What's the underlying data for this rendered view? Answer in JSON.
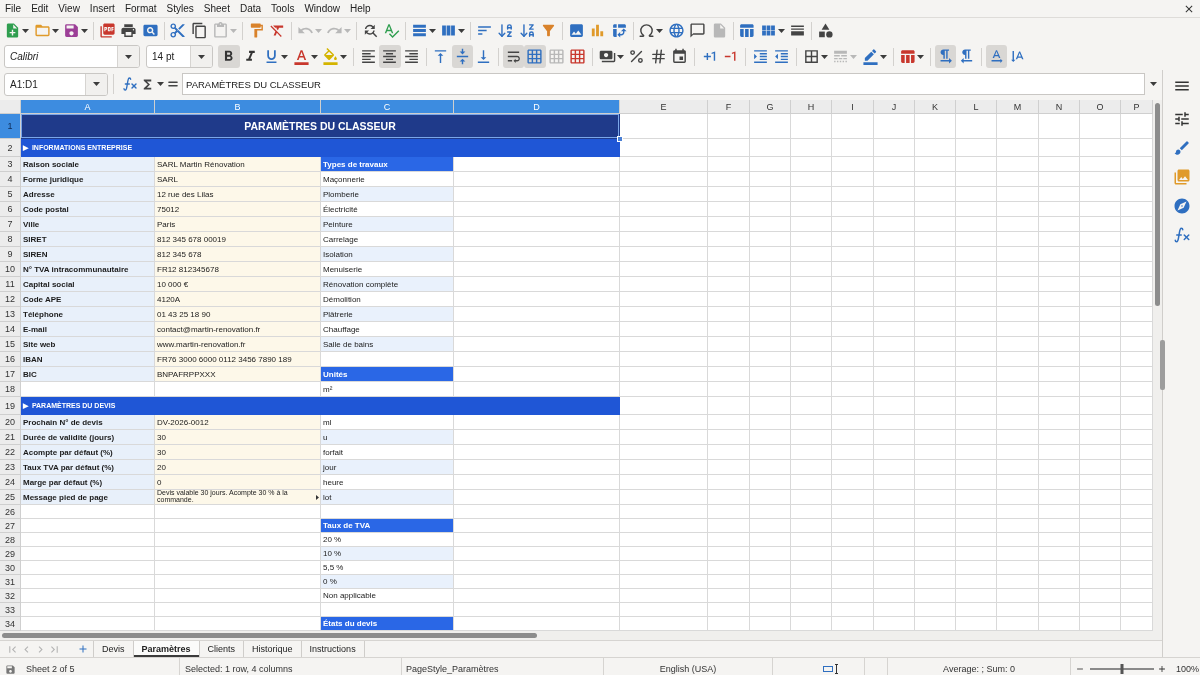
{
  "menu_bar": {
    "items": [
      "File",
      "Edit",
      "View",
      "Insert",
      "Format",
      "Styles",
      "Sheet",
      "Data",
      "Tools",
      "Window",
      "Help"
    ]
  },
  "standard_toolbar": {
    "groups": [
      [
        {
          "kind": "new",
          "dropdown": true,
          "disabled": false
        },
        {
          "kind": "open",
          "dropdown": true,
          "disabled": false
        },
        {
          "kind": "save",
          "dropdown": true,
          "disabled": false
        }
      ],
      [
        {
          "kind": "export_pdf",
          "dropdown": false,
          "disabled": false
        },
        {
          "kind": "print",
          "dropdown": false,
          "disabled": false
        },
        {
          "kind": "print_preview",
          "dropdown": false,
          "disabled": false
        }
      ],
      [
        {
          "kind": "cut",
          "dropdown": false,
          "disabled": false
        },
        {
          "kind": "copy",
          "dropdown": false,
          "disabled": false
        },
        {
          "kind": "paste",
          "dropdown": true,
          "disabled": true
        }
      ],
      [
        {
          "kind": "clone_formatting",
          "dropdown": false,
          "disabled": false
        },
        {
          "kind": "clear_formatting",
          "dropdown": false,
          "disabled": false
        }
      ],
      [
        {
          "kind": "undo",
          "dropdown": true,
          "disabled": true
        },
        {
          "kind": "redo",
          "dropdown": true,
          "disabled": true
        }
      ],
      [
        {
          "kind": "find_replace",
          "dropdown": false,
          "disabled": false
        },
        {
          "kind": "spelling",
          "dropdown": false,
          "disabled": false
        }
      ],
      [
        {
          "kind": "row",
          "dropdown": true,
          "disabled": false
        },
        {
          "kind": "column",
          "dropdown": true,
          "disabled": false
        }
      ],
      [
        {
          "kind": "sort",
          "dropdown": false,
          "disabled": false
        },
        {
          "kind": "sort_ascending",
          "dropdown": false,
          "disabled": false
        },
        {
          "kind": "sort_descending",
          "dropdown": false,
          "disabled": false
        },
        {
          "kind": "autofilter",
          "dropdown": false,
          "disabled": false
        }
      ],
      [
        {
          "kind": "image",
          "dropdown": false,
          "disabled": false
        },
        {
          "kind": "chart",
          "dropdown": false,
          "disabled": false
        },
        {
          "kind": "pivot_table",
          "dropdown": false,
          "disabled": false
        }
      ],
      [
        {
          "kind": "special_character",
          "dropdown": true,
          "disabled": false
        },
        {
          "kind": "hyperlink",
          "dropdown": false,
          "disabled": false
        },
        {
          "kind": "comment",
          "dropdown": false,
          "disabled": false
        },
        {
          "kind": "headers_footers",
          "dropdown": false,
          "disabled": true
        }
      ],
      [
        {
          "kind": "print_area",
          "dropdown": false,
          "disabled": false
        },
        {
          "kind": "freeze",
          "dropdown": true,
          "disabled": false
        },
        {
          "kind": "split_window",
          "dropdown": false,
          "disabled": false
        }
      ],
      [
        {
          "kind": "shapes",
          "dropdown": false,
          "disabled": false
        }
      ]
    ]
  },
  "formatting_toolbar": {
    "font_name": "Calibri",
    "font_size": "14 pt",
    "groups": [
      [
        {
          "kind": "bold",
          "dropdown": false,
          "pressed": true,
          "disabled": false
        },
        {
          "kind": "italic",
          "dropdown": false,
          "pressed": false,
          "disabled": false
        },
        {
          "kind": "underline",
          "dropdown": true,
          "pressed": false,
          "disabled": false
        },
        {
          "kind": "font_color",
          "dropdown": true,
          "pressed": false,
          "disabled": false
        },
        {
          "kind": "highlighting",
          "dropdown": true,
          "pressed": false,
          "disabled": false
        }
      ],
      [
        {
          "kind": "align_left",
          "dropdown": false,
          "pressed": false,
          "disabled": false
        },
        {
          "kind": "align_center",
          "dropdown": false,
          "pressed": true,
          "disabled": false
        },
        {
          "kind": "align_right",
          "dropdown": false,
          "pressed": false,
          "disabled": false
        }
      ],
      [
        {
          "kind": "align_top",
          "dropdown": false,
          "pressed": false,
          "disabled": false
        },
        {
          "kind": "align_middle",
          "dropdown": false,
          "pressed": true,
          "disabled": false
        },
        {
          "kind": "align_bottom",
          "dropdown": false,
          "pressed": false,
          "disabled": false
        }
      ],
      [
        {
          "kind": "wrap_text",
          "dropdown": false,
          "pressed": true,
          "disabled": false
        },
        {
          "kind": "merge_center",
          "dropdown": false,
          "pressed": true,
          "disabled": false
        },
        {
          "kind": "merge",
          "dropdown": false,
          "pressed": false,
          "disabled": true
        },
        {
          "kind": "unmerge",
          "dropdown": false,
          "pressed": false,
          "disabled": false
        }
      ],
      [
        {
          "kind": "currency",
          "dropdown": true,
          "pressed": false,
          "disabled": false
        },
        {
          "kind": "percent",
          "dropdown": false,
          "pressed": false,
          "disabled": false
        },
        {
          "kind": "number",
          "dropdown": false,
          "pressed": false,
          "disabled": false
        },
        {
          "kind": "date",
          "dropdown": false,
          "pressed": false,
          "disabled": false
        }
      ],
      [
        {
          "kind": "add_decimal",
          "dropdown": false,
          "pressed": false,
          "disabled": false
        },
        {
          "kind": "delete_decimal",
          "dropdown": false,
          "pressed": false,
          "disabled": false
        }
      ],
      [
        {
          "kind": "indent_increase",
          "dropdown": false,
          "pressed": false,
          "disabled": false
        },
        {
          "kind": "indent_decrease",
          "dropdown": false,
          "pressed": false,
          "disabled": false
        }
      ],
      [
        {
          "kind": "borders",
          "dropdown": true,
          "pressed": false,
          "disabled": false
        },
        {
          "kind": "border_style",
          "dropdown": true,
          "pressed": false,
          "disabled": true
        },
        {
          "kind": "border_color",
          "dropdown": true,
          "pressed": false,
          "disabled": false
        }
      ],
      [
        {
          "kind": "conditional",
          "dropdown": true,
          "pressed": false,
          "disabled": false
        }
      ],
      [
        {
          "kind": "left_to_right",
          "dropdown": false,
          "pressed": true,
          "disabled": false
        },
        {
          "kind": "right_to_left",
          "dropdown": false,
          "pressed": false,
          "disabled": false
        }
      ],
      [
        {
          "kind": "text_orientation",
          "dropdown": false,
          "pressed": true,
          "disabled": false
        },
        {
          "kind": "vertical_text",
          "dropdown": false,
          "pressed": false,
          "disabled": false
        }
      ]
    ]
  },
  "formula_bar": {
    "name_box": "A1:D1",
    "content": "PARAMÈTRES DU CLASSEUR"
  },
  "sheet": {
    "columns": [
      {
        "label": "A",
        "selected": true
      },
      {
        "label": "B",
        "selected": true
      },
      {
        "label": "C",
        "selected": true
      },
      {
        "label": "D",
        "selected": true
      },
      {
        "label": "E",
        "selected": false
      },
      {
        "label": "F",
        "selected": false
      },
      {
        "label": "G",
        "selected": false
      },
      {
        "label": "H",
        "selected": false
      },
      {
        "label": "I",
        "selected": false
      },
      {
        "label": "J",
        "selected": false
      },
      {
        "label": "K",
        "selected": false
      },
      {
        "label": "L",
        "selected": false
      },
      {
        "label": "M",
        "selected": false
      },
      {
        "label": "N",
        "selected": false
      },
      {
        "label": "O",
        "selected": false
      },
      {
        "label": "P",
        "selected": false
      }
    ],
    "rows": [
      {
        "number": "1",
        "selected": true,
        "kind": "title",
        "title": "PARAMÈTRES DU CLASSEUR"
      },
      {
        "number": "2",
        "selected": false,
        "kind": "section",
        "text": "▶  INFORMATIONS ENTREPRISE"
      },
      {
        "number": "3",
        "selected": false,
        "kind": "data",
        "label": "Raison sociale",
        "value": "SARL Martin Rénovation",
        "clipped": false,
        "list": {
          "kind": "header",
          "text": "Types de travaux"
        }
      },
      {
        "number": "4",
        "selected": false,
        "kind": "data",
        "label": "Forme juridique",
        "value": "SARL",
        "clipped": false,
        "list": {
          "kind": "item",
          "text": "Maçonnerie",
          "shaded": false
        }
      },
      {
        "number": "5",
        "selected": false,
        "kind": "data",
        "label": "Adresse",
        "value": "12 rue des Lilas",
        "clipped": false,
        "list": {
          "kind": "item",
          "text": "Plomberie",
          "shaded": true
        }
      },
      {
        "number": "6",
        "selected": false,
        "kind": "data",
        "label": "Code postal",
        "value": "75012",
        "clipped": false,
        "list": {
          "kind": "item",
          "text": "Électricité",
          "shaded": false
        }
      },
      {
        "number": "7",
        "selected": false,
        "kind": "data",
        "label": "Ville",
        "value": "Paris",
        "clipped": false,
        "list": {
          "kind": "item",
          "text": "Peinture",
          "shaded": true
        }
      },
      {
        "number": "8",
        "selected": false,
        "kind": "data",
        "label": "SIRET",
        "value": "812 345 678 00019",
        "clipped": false,
        "list": {
          "kind": "item",
          "text": "Carrelage",
          "shaded": false
        }
      },
      {
        "number": "9",
        "selected": false,
        "kind": "data",
        "label": "SIREN",
        "value": "812 345 678",
        "clipped": false,
        "list": {
          "kind": "item",
          "text": "Isolation",
          "shaded": true
        }
      },
      {
        "number": "10",
        "selected": false,
        "kind": "data",
        "label": "N° TVA intracommunautaire",
        "value": "FR12 812345678",
        "clipped": false,
        "list": {
          "kind": "item",
          "text": "Menuiserie",
          "shaded": false
        }
      },
      {
        "number": "11",
        "selected": false,
        "kind": "data",
        "label": "Capital social",
        "value": "10 000 €",
        "clipped": false,
        "list": {
          "kind": "item",
          "text": "Rénovation complète",
          "shaded": true
        }
      },
      {
        "number": "12",
        "selected": false,
        "kind": "data",
        "label": "Code APE",
        "value": "4120A",
        "clipped": false,
        "list": {
          "kind": "item",
          "text": "Démolition",
          "shaded": false
        }
      },
      {
        "number": "13",
        "selected": false,
        "kind": "data",
        "label": "Téléphone",
        "value": "01 43 25 18 90",
        "clipped": false,
        "list": {
          "kind": "item",
          "text": "Plâtrerie",
          "shaded": true
        }
      },
      {
        "number": "14",
        "selected": false,
        "kind": "data",
        "label": "E-mail",
        "value": "contact@martin-renovation.fr",
        "clipped": false,
        "list": {
          "kind": "item",
          "text": "Chauffage",
          "shaded": false
        }
      },
      {
        "number": "15",
        "selected": false,
        "kind": "data",
        "label": "Site web",
        "value": "www.martin-renovation.fr",
        "clipped": false,
        "list": {
          "kind": "item",
          "text": "Salle de bains",
          "shaded": true
        }
      },
      {
        "number": "16",
        "selected": false,
        "kind": "data",
        "label": "IBAN",
        "value": "FR76 3000 6000 0112 3456 7890 189",
        "clipped": false
      },
      {
        "number": "17",
        "selected": false,
        "kind": "data",
        "label": "BIC",
        "value": "BNPAFRPPXXX",
        "clipped": false,
        "list": {
          "kind": "header",
          "text": "Unités"
        }
      },
      {
        "number": "18",
        "selected": false,
        "kind": "data",
        "list": {
          "kind": "item",
          "text": "m²",
          "shaded": false
        }
      },
      {
        "number": "19",
        "selected": false,
        "kind": "section",
        "text": "▶  PARAMÈTRES DU DEVIS"
      },
      {
        "number": "20",
        "selected": false,
        "kind": "data",
        "label": "Prochain N° de devis",
        "value": "DV-2026-0012",
        "clipped": false,
        "list": {
          "kind": "item",
          "text": "ml",
          "shaded": false
        }
      },
      {
        "number": "21",
        "selected": false,
        "kind": "data",
        "label": "Durée de validité (jours)",
        "value": "30",
        "clipped": false,
        "list": {
          "kind": "item",
          "text": "u",
          "shaded": true
        }
      },
      {
        "number": "22",
        "selected": false,
        "kind": "data",
        "label": "Acompte par défaut (%)",
        "value": "30",
        "clipped": false,
        "list": {
          "kind": "item",
          "text": "forfait",
          "shaded": false
        }
      },
      {
        "number": "23",
        "selected": false,
        "kind": "data",
        "label": "Taux TVA par défaut (%)",
        "value": "20",
        "clipped": false,
        "list": {
          "kind": "item",
          "text": "jour",
          "shaded": true
        }
      },
      {
        "number": "24",
        "selected": false,
        "kind": "data",
        "label": "Marge par défaut (%)",
        "value": "0",
        "clipped": false,
        "list": {
          "kind": "item",
          "text": "heure",
          "shaded": false
        }
      },
      {
        "number": "25",
        "selected": false,
        "kind": "data",
        "label": "Message pied de page",
        "value": "Devis valable 30 jours. Acompte 30 % à la commande.",
        "clipped": true,
        "list": {
          "kind": "item",
          "text": "lot",
          "shaded": true
        }
      },
      {
        "number": "26",
        "selected": false,
        "kind": "data"
      },
      {
        "number": "27",
        "selected": false,
        "kind": "data",
        "list": {
          "kind": "header",
          "text": "Taux de TVA"
        }
      },
      {
        "number": "28",
        "selected": false,
        "kind": "data",
        "list": {
          "kind": "item",
          "text": "20 %",
          "shaded": false
        }
      },
      {
        "number": "29",
        "selected": false,
        "kind": "data",
        "list": {
          "kind": "item",
          "text": "10 %",
          "shaded": true
        }
      },
      {
        "number": "30",
        "selected": false,
        "kind": "data",
        "list": {
          "kind": "item",
          "text": "5,5 %",
          "shaded": false
        }
      },
      {
        "number": "31",
        "selected": false,
        "kind": "data",
        "list": {
          "kind": "item",
          "text": "0 %",
          "shaded": true
        }
      },
      {
        "number": "32",
        "selected": false,
        "kind": "data",
        "list": {
          "kind": "item",
          "text": "Non applicable",
          "shaded": false
        }
      },
      {
        "number": "33",
        "selected": false,
        "kind": "data"
      },
      {
        "number": "34",
        "selected": false,
        "kind": "data",
        "list": {
          "kind": "header",
          "text": "États du devis"
        }
      }
    ]
  },
  "sheet_tabs": [
    {
      "label": "Devis",
      "selected": false
    },
    {
      "label": "Paramètres",
      "selected": true
    },
    {
      "label": "Clients",
      "selected": false
    },
    {
      "label": "Historique",
      "selected": false
    },
    {
      "label": "Instructions",
      "selected": false
    }
  ],
  "status_bar": {
    "sheet_position": "Sheet 2 of 5",
    "selection": "Selected: 1 row, 4 columns",
    "page_style": "PageStyle_Paramètres",
    "language": "English (USA)",
    "summary": "Average: ; Sum: 0",
    "zoom_slider": {
      "level": 0.5
    },
    "zoom": "100%"
  }
}
